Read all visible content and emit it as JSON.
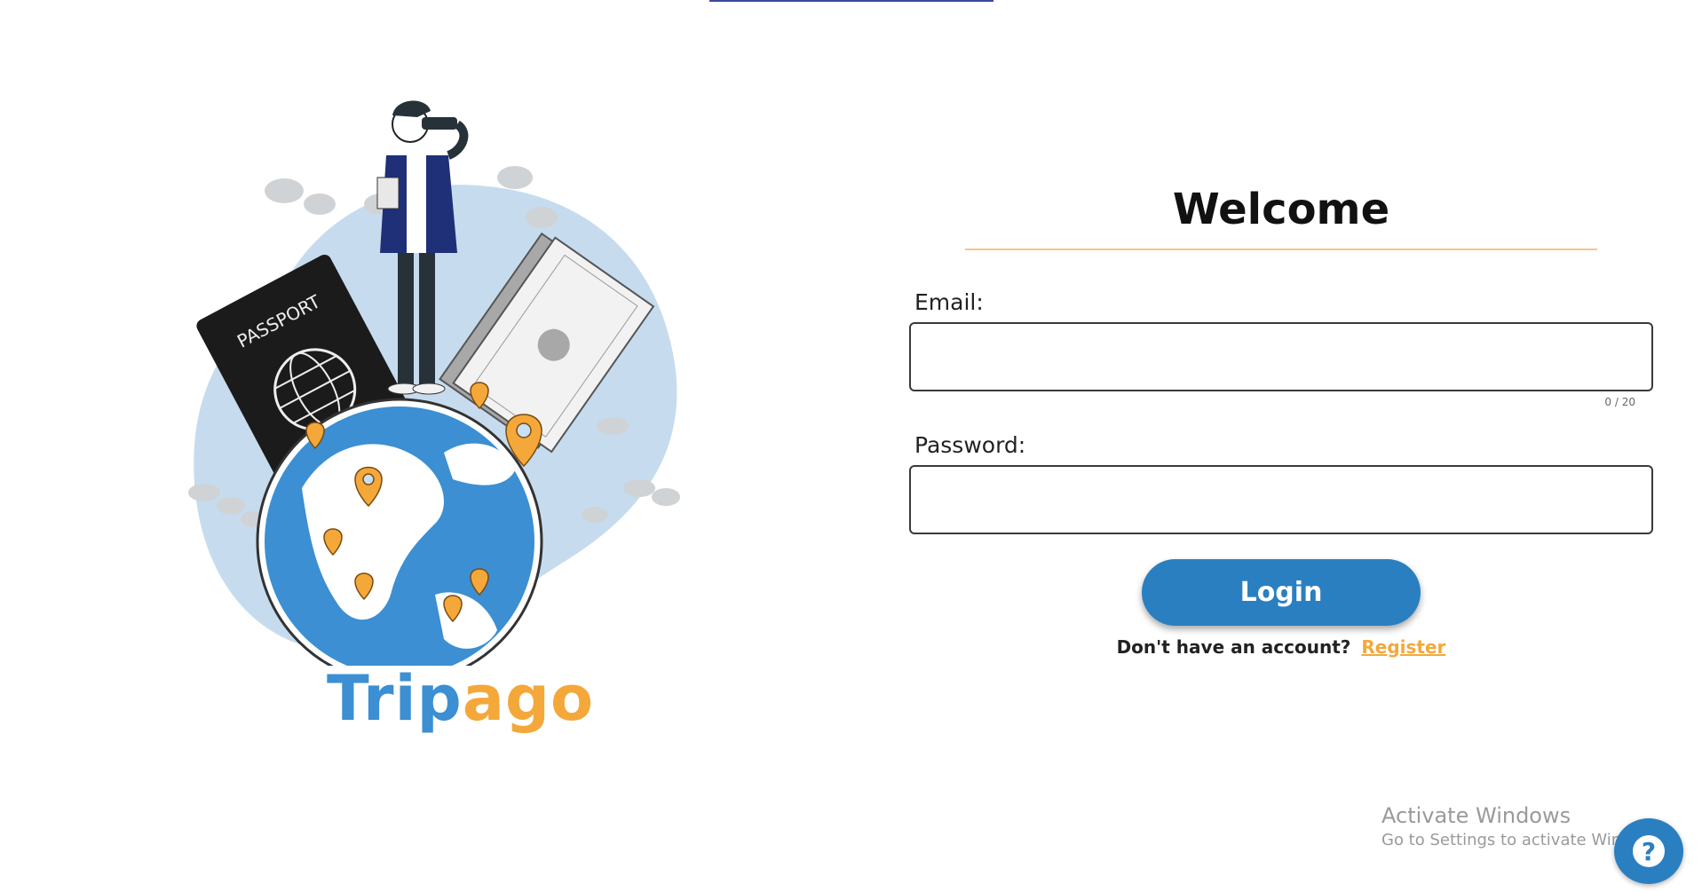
{
  "brand": {
    "part1": "Trip",
    "part2": "ago"
  },
  "illustration": {
    "passport_text": "PASSPORT"
  },
  "form": {
    "title": "Welcome",
    "email_label": "Email:",
    "email_value": "",
    "email_counter": "0 / 20",
    "password_label": "Password:",
    "password_value": "",
    "login_label": "Login",
    "no_account_text": "Don't have an account?",
    "register_label": "Register"
  },
  "watermark": {
    "title": "Activate Windows",
    "subtitle": "Go to Settings to activate Windows."
  },
  "help": {
    "icon_glyph": "?",
    "icon": "question-icon"
  },
  "colors": {
    "primary": "#2a7fc1",
    "accent": "#f4a83a",
    "brand_blue": "#3b8fd2"
  }
}
